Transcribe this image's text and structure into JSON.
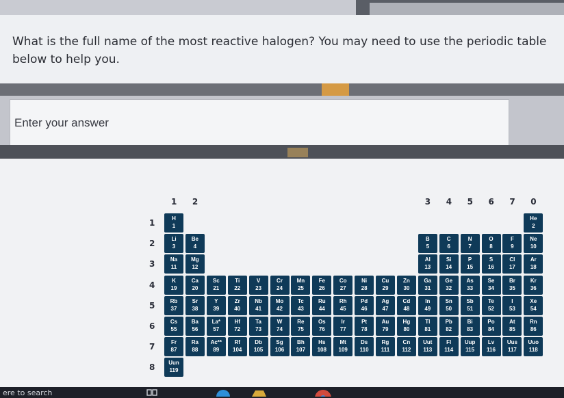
{
  "question": {
    "text": "What is the full name of the most reactive halogen? You may need to use the periodic table below to help you."
  },
  "answer": {
    "placeholder": "Enter your answer",
    "value": ""
  },
  "periodic_table": {
    "group_labels": [
      "1",
      "2",
      "3",
      "4",
      "5",
      "6",
      "7",
      "0"
    ],
    "period_labels": [
      "1",
      "2",
      "3",
      "4",
      "5",
      "6",
      "7",
      "8"
    ],
    "cell_color": "#0f3a58",
    "elements": [
      {
        "symbol": "H",
        "number": "1"
      },
      {
        "symbol": "He",
        "number": "2"
      },
      {
        "symbol": "Li",
        "number": "3"
      },
      {
        "symbol": "Be",
        "number": "4"
      },
      {
        "symbol": "B",
        "number": "5"
      },
      {
        "symbol": "C",
        "number": "6"
      },
      {
        "symbol": "N",
        "number": "7"
      },
      {
        "symbol": "O",
        "number": "8"
      },
      {
        "symbol": "F",
        "number": "9"
      },
      {
        "symbol": "Ne",
        "number": "10"
      },
      {
        "symbol": "Na",
        "number": "11"
      },
      {
        "symbol": "Mg",
        "number": "12"
      },
      {
        "symbol": "Al",
        "number": "13"
      },
      {
        "symbol": "Si",
        "number": "14"
      },
      {
        "symbol": "P",
        "number": "15"
      },
      {
        "symbol": "S",
        "number": "16"
      },
      {
        "symbol": "Cl",
        "number": "17"
      },
      {
        "symbol": "Ar",
        "number": "18"
      },
      {
        "symbol": "K",
        "number": "19"
      },
      {
        "symbol": "Ca",
        "number": "20"
      },
      {
        "symbol": "Sc",
        "number": "21"
      },
      {
        "symbol": "Ti",
        "number": "22"
      },
      {
        "symbol": "V",
        "number": "23"
      },
      {
        "symbol": "Cr",
        "number": "24"
      },
      {
        "symbol": "Mn",
        "number": "25"
      },
      {
        "symbol": "Fe",
        "number": "26"
      },
      {
        "symbol": "Co",
        "number": "27"
      },
      {
        "symbol": "Ni",
        "number": "28"
      },
      {
        "symbol": "Cu",
        "number": "29"
      },
      {
        "symbol": "Zn",
        "number": "30"
      },
      {
        "symbol": "Ga",
        "number": "31"
      },
      {
        "symbol": "Ge",
        "number": "32"
      },
      {
        "symbol": "As",
        "number": "33"
      },
      {
        "symbol": "Se",
        "number": "34"
      },
      {
        "symbol": "Br",
        "number": "35"
      },
      {
        "symbol": "Kr",
        "number": "36"
      },
      {
        "symbol": "Rb",
        "number": "37"
      },
      {
        "symbol": "Sr",
        "number": "38"
      },
      {
        "symbol": "Y",
        "number": "39"
      },
      {
        "symbol": "Zr",
        "number": "40"
      },
      {
        "symbol": "Nb",
        "number": "41"
      },
      {
        "symbol": "Mo",
        "number": "42"
      },
      {
        "symbol": "Tc",
        "number": "43"
      },
      {
        "symbol": "Ru",
        "number": "44"
      },
      {
        "symbol": "Rh",
        "number": "45"
      },
      {
        "symbol": "Pd",
        "number": "46"
      },
      {
        "symbol": "Ag",
        "number": "47"
      },
      {
        "symbol": "Cd",
        "number": "48"
      },
      {
        "symbol": "In",
        "number": "49"
      },
      {
        "symbol": "Sn",
        "number": "50"
      },
      {
        "symbol": "Sb",
        "number": "51"
      },
      {
        "symbol": "Te",
        "number": "52"
      },
      {
        "symbol": "I",
        "number": "53"
      },
      {
        "symbol": "Xe",
        "number": "54"
      },
      {
        "symbol": "Cs",
        "number": "55"
      },
      {
        "symbol": "Ba",
        "number": "56"
      },
      {
        "symbol": "La*",
        "number": "57"
      },
      {
        "symbol": "Hf",
        "number": "72"
      },
      {
        "symbol": "Ta",
        "number": "73"
      },
      {
        "symbol": "W",
        "number": "74"
      },
      {
        "symbol": "Re",
        "number": "75"
      },
      {
        "symbol": "Os",
        "number": "76"
      },
      {
        "symbol": "Ir",
        "number": "77"
      },
      {
        "symbol": "Pt",
        "number": "78"
      },
      {
        "symbol": "Au",
        "number": "79"
      },
      {
        "symbol": "Hg",
        "number": "80"
      },
      {
        "symbol": "Tl",
        "number": "81"
      },
      {
        "symbol": "Pb",
        "number": "82"
      },
      {
        "symbol": "Bi",
        "number": "83"
      },
      {
        "symbol": "Po",
        "number": "84"
      },
      {
        "symbol": "At",
        "number": "85"
      },
      {
        "symbol": "Rn",
        "number": "86"
      },
      {
        "symbol": "Fr",
        "number": "87"
      },
      {
        "symbol": "Ra",
        "number": "88"
      },
      {
        "symbol": "Ac**",
        "number": "89"
      },
      {
        "symbol": "Rf",
        "number": "104"
      },
      {
        "symbol": "Db",
        "number": "105"
      },
      {
        "symbol": "Sg",
        "number": "106"
      },
      {
        "symbol": "Bh",
        "number": "107"
      },
      {
        "symbol": "Hs",
        "number": "108"
      },
      {
        "symbol": "Mt",
        "number": "109"
      },
      {
        "symbol": "Ds",
        "number": "110"
      },
      {
        "symbol": "Rg",
        "number": "111"
      },
      {
        "symbol": "Cn",
        "number": "112"
      },
      {
        "symbol": "Uut",
        "number": "113"
      },
      {
        "symbol": "Fl",
        "number": "114"
      },
      {
        "symbol": "Uup",
        "number": "115"
      },
      {
        "symbol": "Lv",
        "number": "116"
      },
      {
        "symbol": "Uus",
        "number": "117"
      },
      {
        "symbol": "Uuo",
        "number": "118"
      },
      {
        "symbol": "Uun",
        "number": "119"
      }
    ]
  },
  "taskbar": {
    "search_text": "ere to search",
    "icons": [
      "task-view-icon",
      "edge-browser-icon",
      "file-explorer-icon",
      "chrome-icon"
    ]
  }
}
